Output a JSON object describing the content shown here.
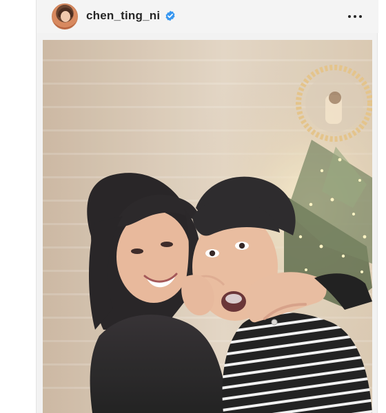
{
  "post": {
    "username": "chen_ting_ni",
    "verified": true,
    "verified_color": "#3897f0",
    "icons": {
      "avatar": "avatar-icon",
      "verified": "verified-badge-icon",
      "more": "more-options-icon"
    },
    "photo": {
      "background": "#d9c7b3",
      "tree_color": "#4a5f3a",
      "wreath_color": "#e5c18a"
    }
  }
}
